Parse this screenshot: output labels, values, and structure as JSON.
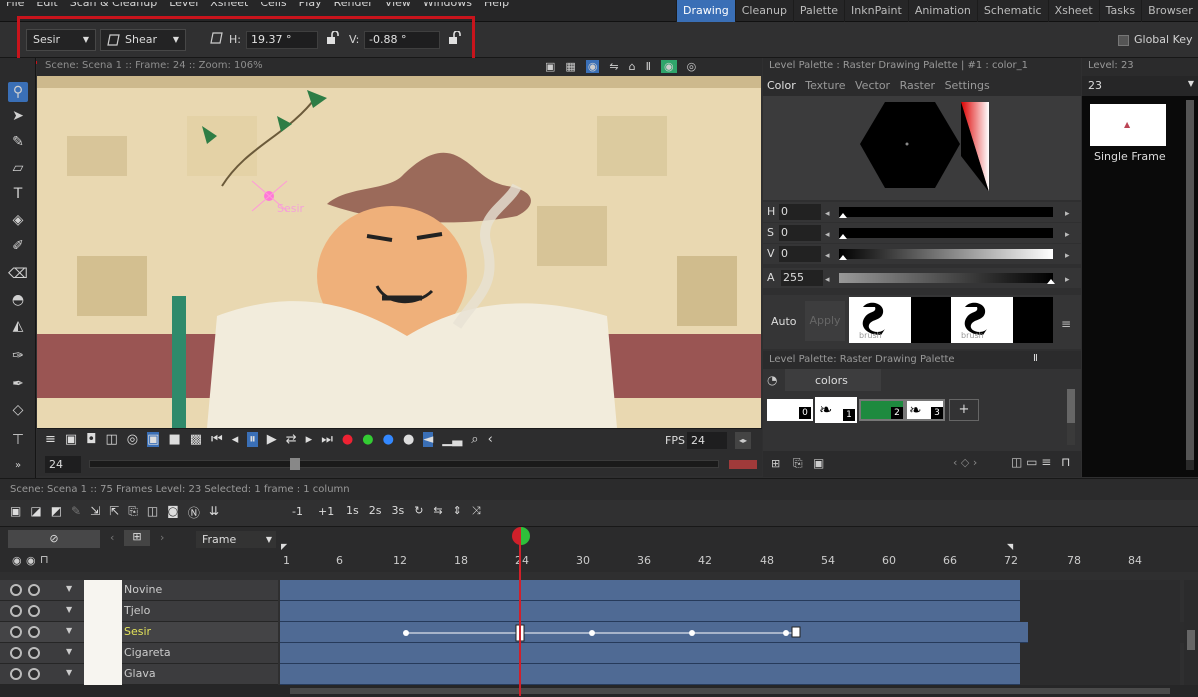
{
  "menubar": {
    "items": [
      "File",
      "Edit",
      "Scan & Cleanup",
      "Level",
      "Xsheet",
      "Cells",
      "Play",
      "Render",
      "View",
      "Windows",
      "Help"
    ],
    "rooms": [
      "Drawing",
      "Cleanup",
      "Palette",
      "InknPaint",
      "Animation",
      "Schematic",
      "Xsheet",
      "Tasks",
      "Browser"
    ],
    "active_room": "Drawing"
  },
  "tool_options": {
    "object": "Sesir",
    "mode": "Shear",
    "h_label": "H:",
    "h_value": "19.37 °",
    "v_label": "V:",
    "v_value": "-0.88 °",
    "global_key": "Global Key"
  },
  "viewer": {
    "title": "Scene: Scena 1  ::  Frame: 24  ::  Zoom: 106%",
    "fps_label": "FPS",
    "fps_value": "24",
    "frame_field": "24",
    "stage_label": "Sesir"
  },
  "palette": {
    "title": "Level Palette : Raster Drawing Palette | #1 : color_1",
    "tabs": [
      "Color",
      "Texture",
      "Vector",
      "Raster",
      "Settings"
    ],
    "active_tab": "Color",
    "sliders": [
      {
        "key": "H",
        "value": "0"
      },
      {
        "key": "S",
        "value": "0"
      },
      {
        "key": "V",
        "value": "0"
      },
      {
        "key": "A",
        "value": "255"
      }
    ],
    "auto_label": "Auto",
    "apply_label": "Apply",
    "brush_label_1": "brush",
    "brush_label_2": "brush",
    "palette2_title": "Level Palette: Raster Drawing Palette",
    "palette2_tab": "colors",
    "chips": [
      "0",
      "1",
      "2",
      "3"
    ],
    "add_label": "+"
  },
  "level_strip": {
    "title": "Level: 23",
    "field": "23",
    "frame_label": "Single Frame"
  },
  "xsheet": {
    "info": "Scene: Scena 1  ::  75 Frames  Level: 23  Selected: 1 frame : 1 column",
    "frame_combo": "Frame",
    "toolbar_minus": "-1",
    "toolbar_plus": "+1",
    "ruler": [
      "1",
      "6",
      "12",
      "18",
      "24",
      "30",
      "36",
      "42",
      "48",
      "54",
      "60",
      "66",
      "72",
      "78",
      "84"
    ],
    "current_frame": 24,
    "total_frames": 75,
    "layers": [
      {
        "name": "Novine",
        "color": "#dddddd"
      },
      {
        "name": "Tjelo",
        "color": "#dddddd"
      },
      {
        "name": "Sesir",
        "color": "#e3e35a"
      },
      {
        "name": "Cigareta",
        "color": "#dddddd"
      },
      {
        "name": "Glava",
        "color": "#dddddd"
      }
    ]
  },
  "colors": {
    "accent": "#3a6fb6",
    "highlight": "#c8141c",
    "playhead": "#d0202a",
    "cells": "#4f6a94"
  }
}
